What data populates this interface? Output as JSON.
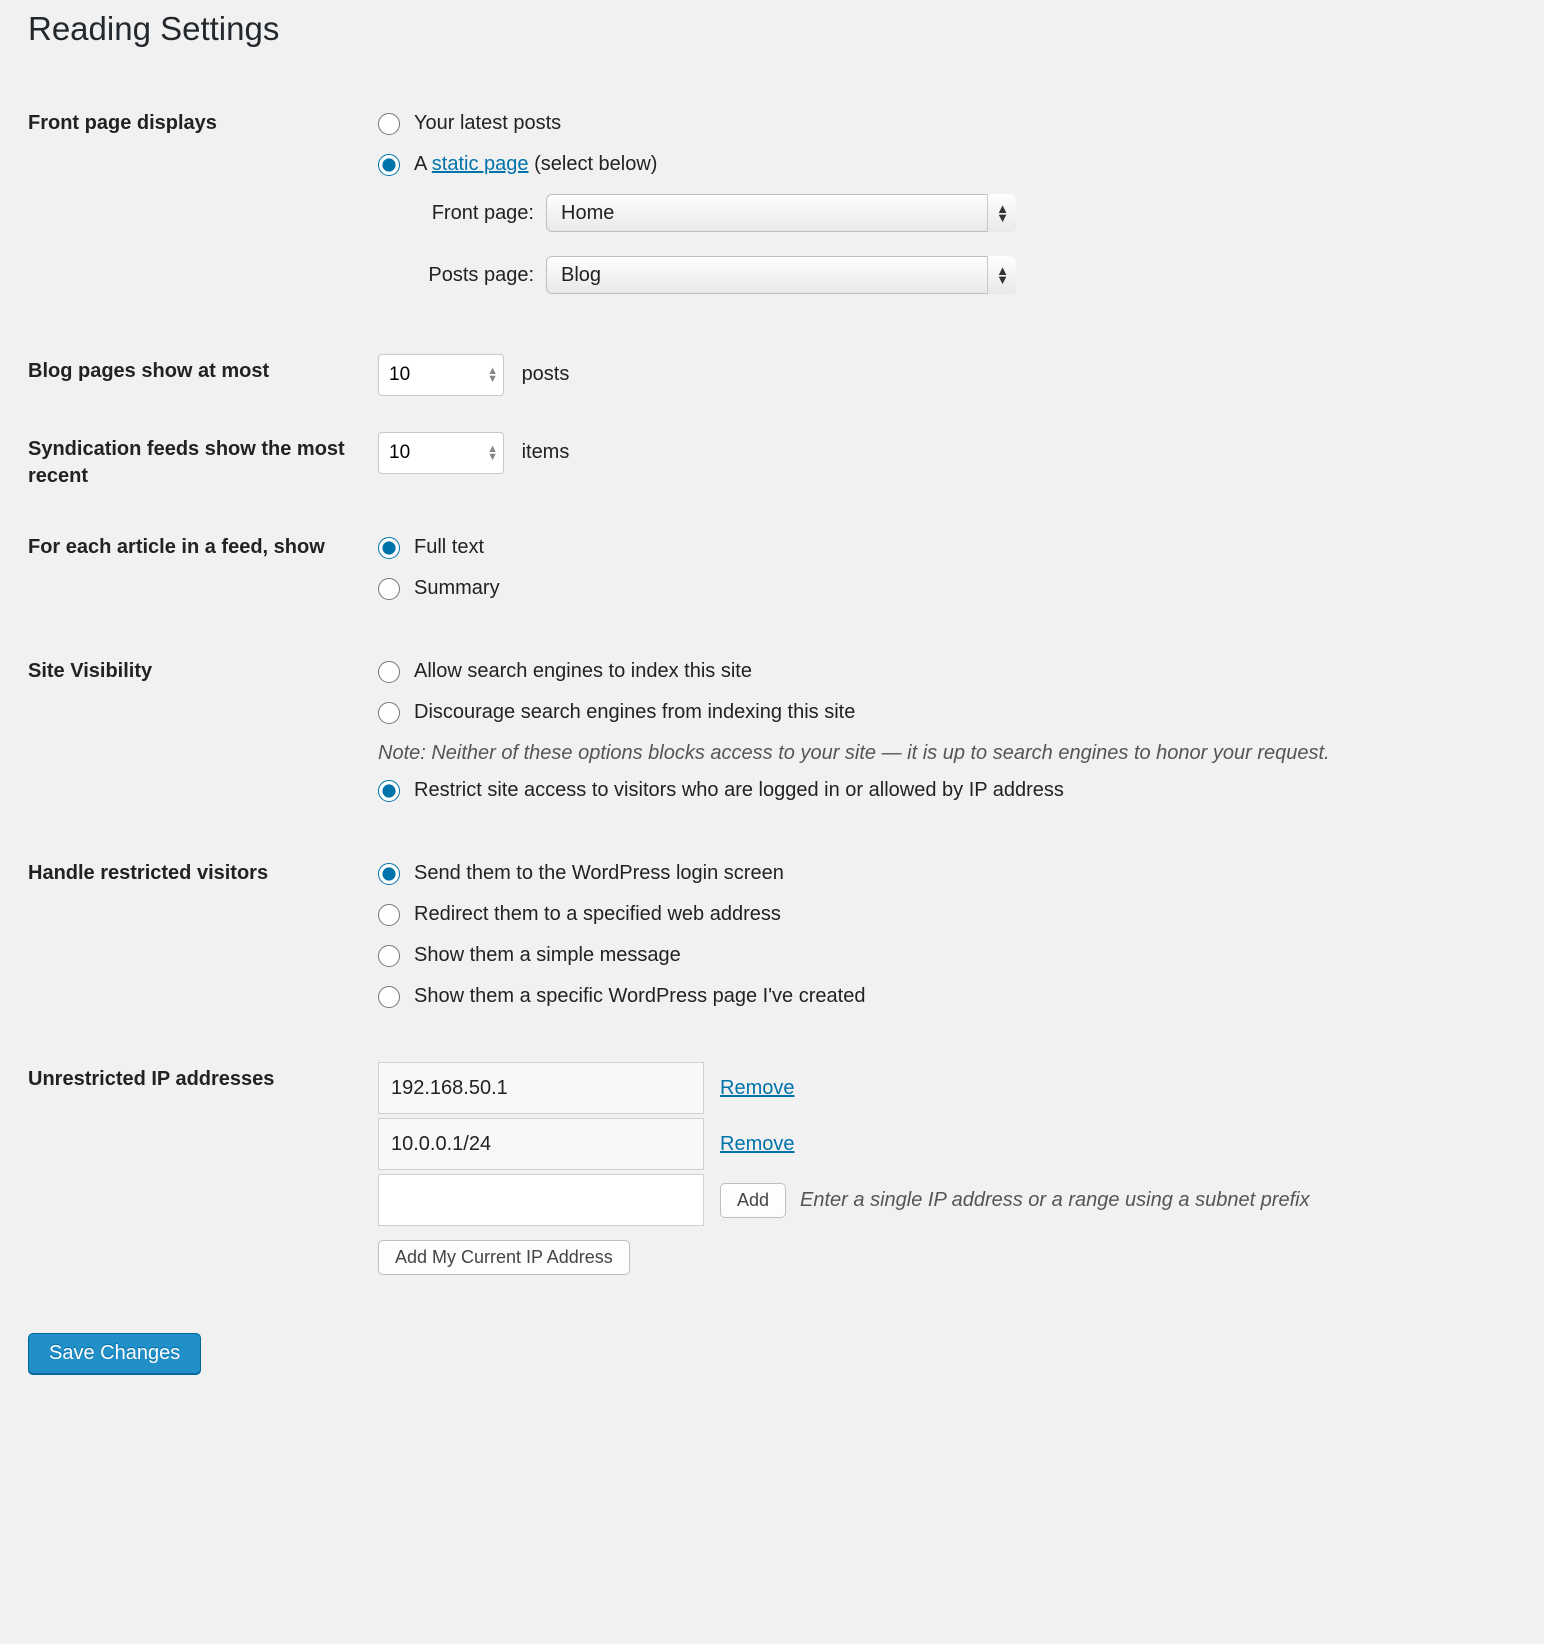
{
  "page_title": "Reading Settings",
  "front_page": {
    "row_label": "Front page displays",
    "options": {
      "latest": "Your latest posts",
      "static_prefix": "A ",
      "static_link": "static page",
      "static_suffix": " (select below)"
    },
    "front_page_label": "Front page:",
    "front_page_value": "Home",
    "posts_page_label": "Posts page:",
    "posts_page_value": "Blog"
  },
  "blog_pages": {
    "row_label": "Blog pages show at most",
    "value": "10",
    "unit": "posts"
  },
  "syndication": {
    "row_label": "Syndication feeds show the most recent",
    "value": "10",
    "unit": "items"
  },
  "feed_content": {
    "row_label": "For each article in a feed, show",
    "full": "Full text",
    "summary": "Summary"
  },
  "site_visibility": {
    "row_label": "Site Visibility",
    "allow": "Allow search engines to index this site",
    "discourage": "Discourage search engines from indexing this site",
    "note": "Note: Neither of these options blocks access to your site — it is up to search engines to honor your request.",
    "restrict": "Restrict site access to visitors who are logged in or allowed by IP address"
  },
  "restricted": {
    "row_label": "Handle restricted visitors",
    "login": "Send them to the WordPress login screen",
    "redirect": "Redirect them to a specified web address",
    "message": "Show them a simple message",
    "page": "Show them a specific WordPress page I've created"
  },
  "ip": {
    "row_label": "Unrestricted IP addresses",
    "list": [
      "192.168.50.1",
      "10.0.0.1/24"
    ],
    "remove": "Remove",
    "add": "Add",
    "hint": "Enter a single IP address or a range using a subnet prefix",
    "add_current": "Add My Current IP Address"
  },
  "save": "Save Changes"
}
